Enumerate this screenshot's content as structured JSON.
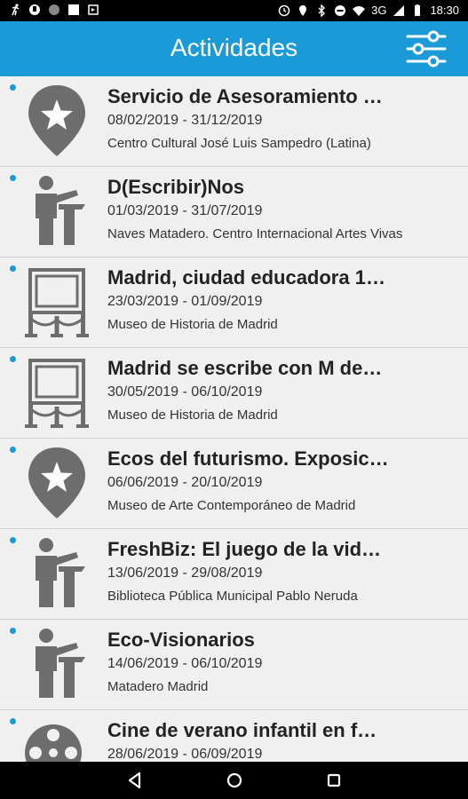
{
  "status_bar": {
    "network": "3G",
    "time": "18:30"
  },
  "app_bar": {
    "title": "Actividades",
    "filter_icon": "sliders-icon"
  },
  "colors": {
    "accent": "#1a9ad6",
    "icon_gray": "#6d6d6d"
  },
  "activities": [
    {
      "title": "Servicio de Asesoramiento …",
      "dates": "08/02/2019 - 31/12/2019",
      "place": "Centro Cultural José Luis Sampedro (Latina)",
      "icon": "star-pin-icon"
    },
    {
      "title": "D(Escribir)Nos",
      "dates": "01/03/2019 - 31/07/2019",
      "place": "Naves Matadero. Centro Internacional Artes Vivas",
      "icon": "speaker-podium-icon"
    },
    {
      "title": "Madrid, ciudad educadora 1…",
      "dates": "23/03/2019 - 01/09/2019",
      "place": "Museo de Historia de Madrid",
      "icon": "museum-exhibit-icon"
    },
    {
      "title": "Madrid se escribe con M de…",
      "dates": "30/05/2019 - 06/10/2019",
      "place": "Museo de Historia de Madrid",
      "icon": "museum-exhibit-icon"
    },
    {
      "title": "Ecos del futurismo. Exposic…",
      "dates": "06/06/2019 - 20/10/2019",
      "place": "Museo de Arte Contemporáneo de Madrid",
      "icon": "star-pin-icon"
    },
    {
      "title": "FreshBiz: El juego de la vid…",
      "dates": "13/06/2019 - 29/08/2019",
      "place": "Biblioteca Pública Municipal Pablo Neruda",
      "icon": "speaker-podium-icon"
    },
    {
      "title": "Eco-Visionarios",
      "dates": "14/06/2019 - 06/10/2019",
      "place": "Matadero Madrid",
      "icon": "speaker-podium-icon"
    },
    {
      "title": "Cine de verano infantil en f…",
      "dates": "28/06/2019 - 06/09/2019",
      "place": "",
      "icon": "film-reel-icon"
    }
  ]
}
